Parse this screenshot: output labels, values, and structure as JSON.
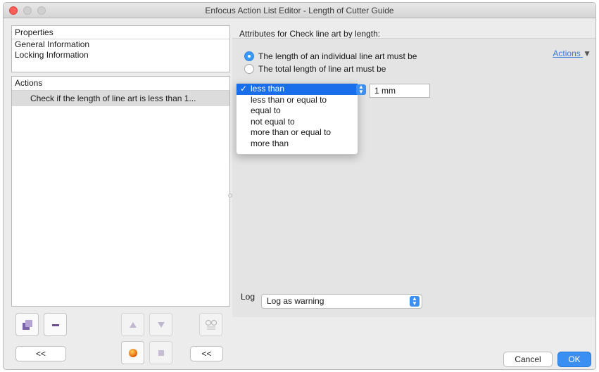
{
  "window": {
    "title": "Enfocus Action List Editor - Length of Cutter Guide"
  },
  "properties": {
    "header": "Properties",
    "items": [
      "General Information",
      "Locking Information"
    ]
  },
  "actions_panel": {
    "header": "Actions",
    "items": [
      "Check if the length of line art is less than 1..."
    ]
  },
  "bottom_left": {
    "collapse_left_label": "<<",
    "collapse_mid_label": "<<"
  },
  "right": {
    "header": "Attributes for Check line art by length:",
    "actions_link": "Actions",
    "radio_options": [
      "The length of an individual line art must be",
      "The total length of line art must be"
    ],
    "comparison_options": [
      "less than",
      "less than or equal to",
      "equal to",
      "not equal to",
      "more than or equal to",
      "more than"
    ],
    "comparison_selected": "less than",
    "length_value": "1 mm",
    "log_label": "Log",
    "log_value": "Log as warning"
  },
  "footer": {
    "cancel_label": "Cancel",
    "ok_label": "OK"
  },
  "colors": {
    "accent": "#3b99fc",
    "selection": "#1a6eea",
    "close": "#fc5f57"
  }
}
